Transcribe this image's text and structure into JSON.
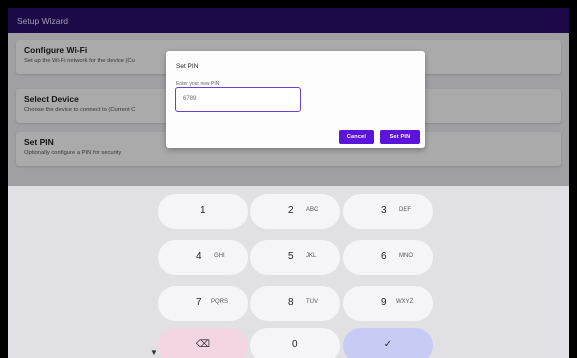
{
  "appbar": {
    "title": "Setup Wizard"
  },
  "cards": [
    {
      "title": "Configure Wi-Fi",
      "subtitle": "Set up the Wi-Fi network for the device (Cu"
    },
    {
      "title": "Select Device",
      "subtitle": "Choose the device to connect to (Current C"
    },
    {
      "title": "Set PIN",
      "subtitle": "Optionally configure a PIN for security"
    }
  ],
  "dialog": {
    "title": "Set PIN",
    "field_label": "Enter your new PIN:",
    "field_value": "6789",
    "cancel_label": "Cancel",
    "confirm_label": "Set PIN"
  },
  "keyboard": {
    "keys": [
      {
        "num": "1",
        "letters": ""
      },
      {
        "num": "2",
        "letters": "ABC"
      },
      {
        "num": "3",
        "letters": "DEF"
      },
      {
        "num": "4",
        "letters": "GHI"
      },
      {
        "num": "5",
        "letters": "JKL"
      },
      {
        "num": "6",
        "letters": "MNO"
      },
      {
        "num": "7",
        "letters": "PQRS"
      },
      {
        "num": "8",
        "letters": "TUV"
      },
      {
        "num": "9",
        "letters": "WXYZ"
      },
      {
        "num": "0",
        "letters": ""
      }
    ],
    "backspace_glyph": "⌫",
    "enter_glyph": "✓",
    "collapse_glyph": "▼"
  },
  "colors": {
    "appbar": "#2a0f6b",
    "accent": "#5b14d9",
    "backspace_key": "#f3d5e3",
    "enter_key": "#c8cbf4"
  }
}
